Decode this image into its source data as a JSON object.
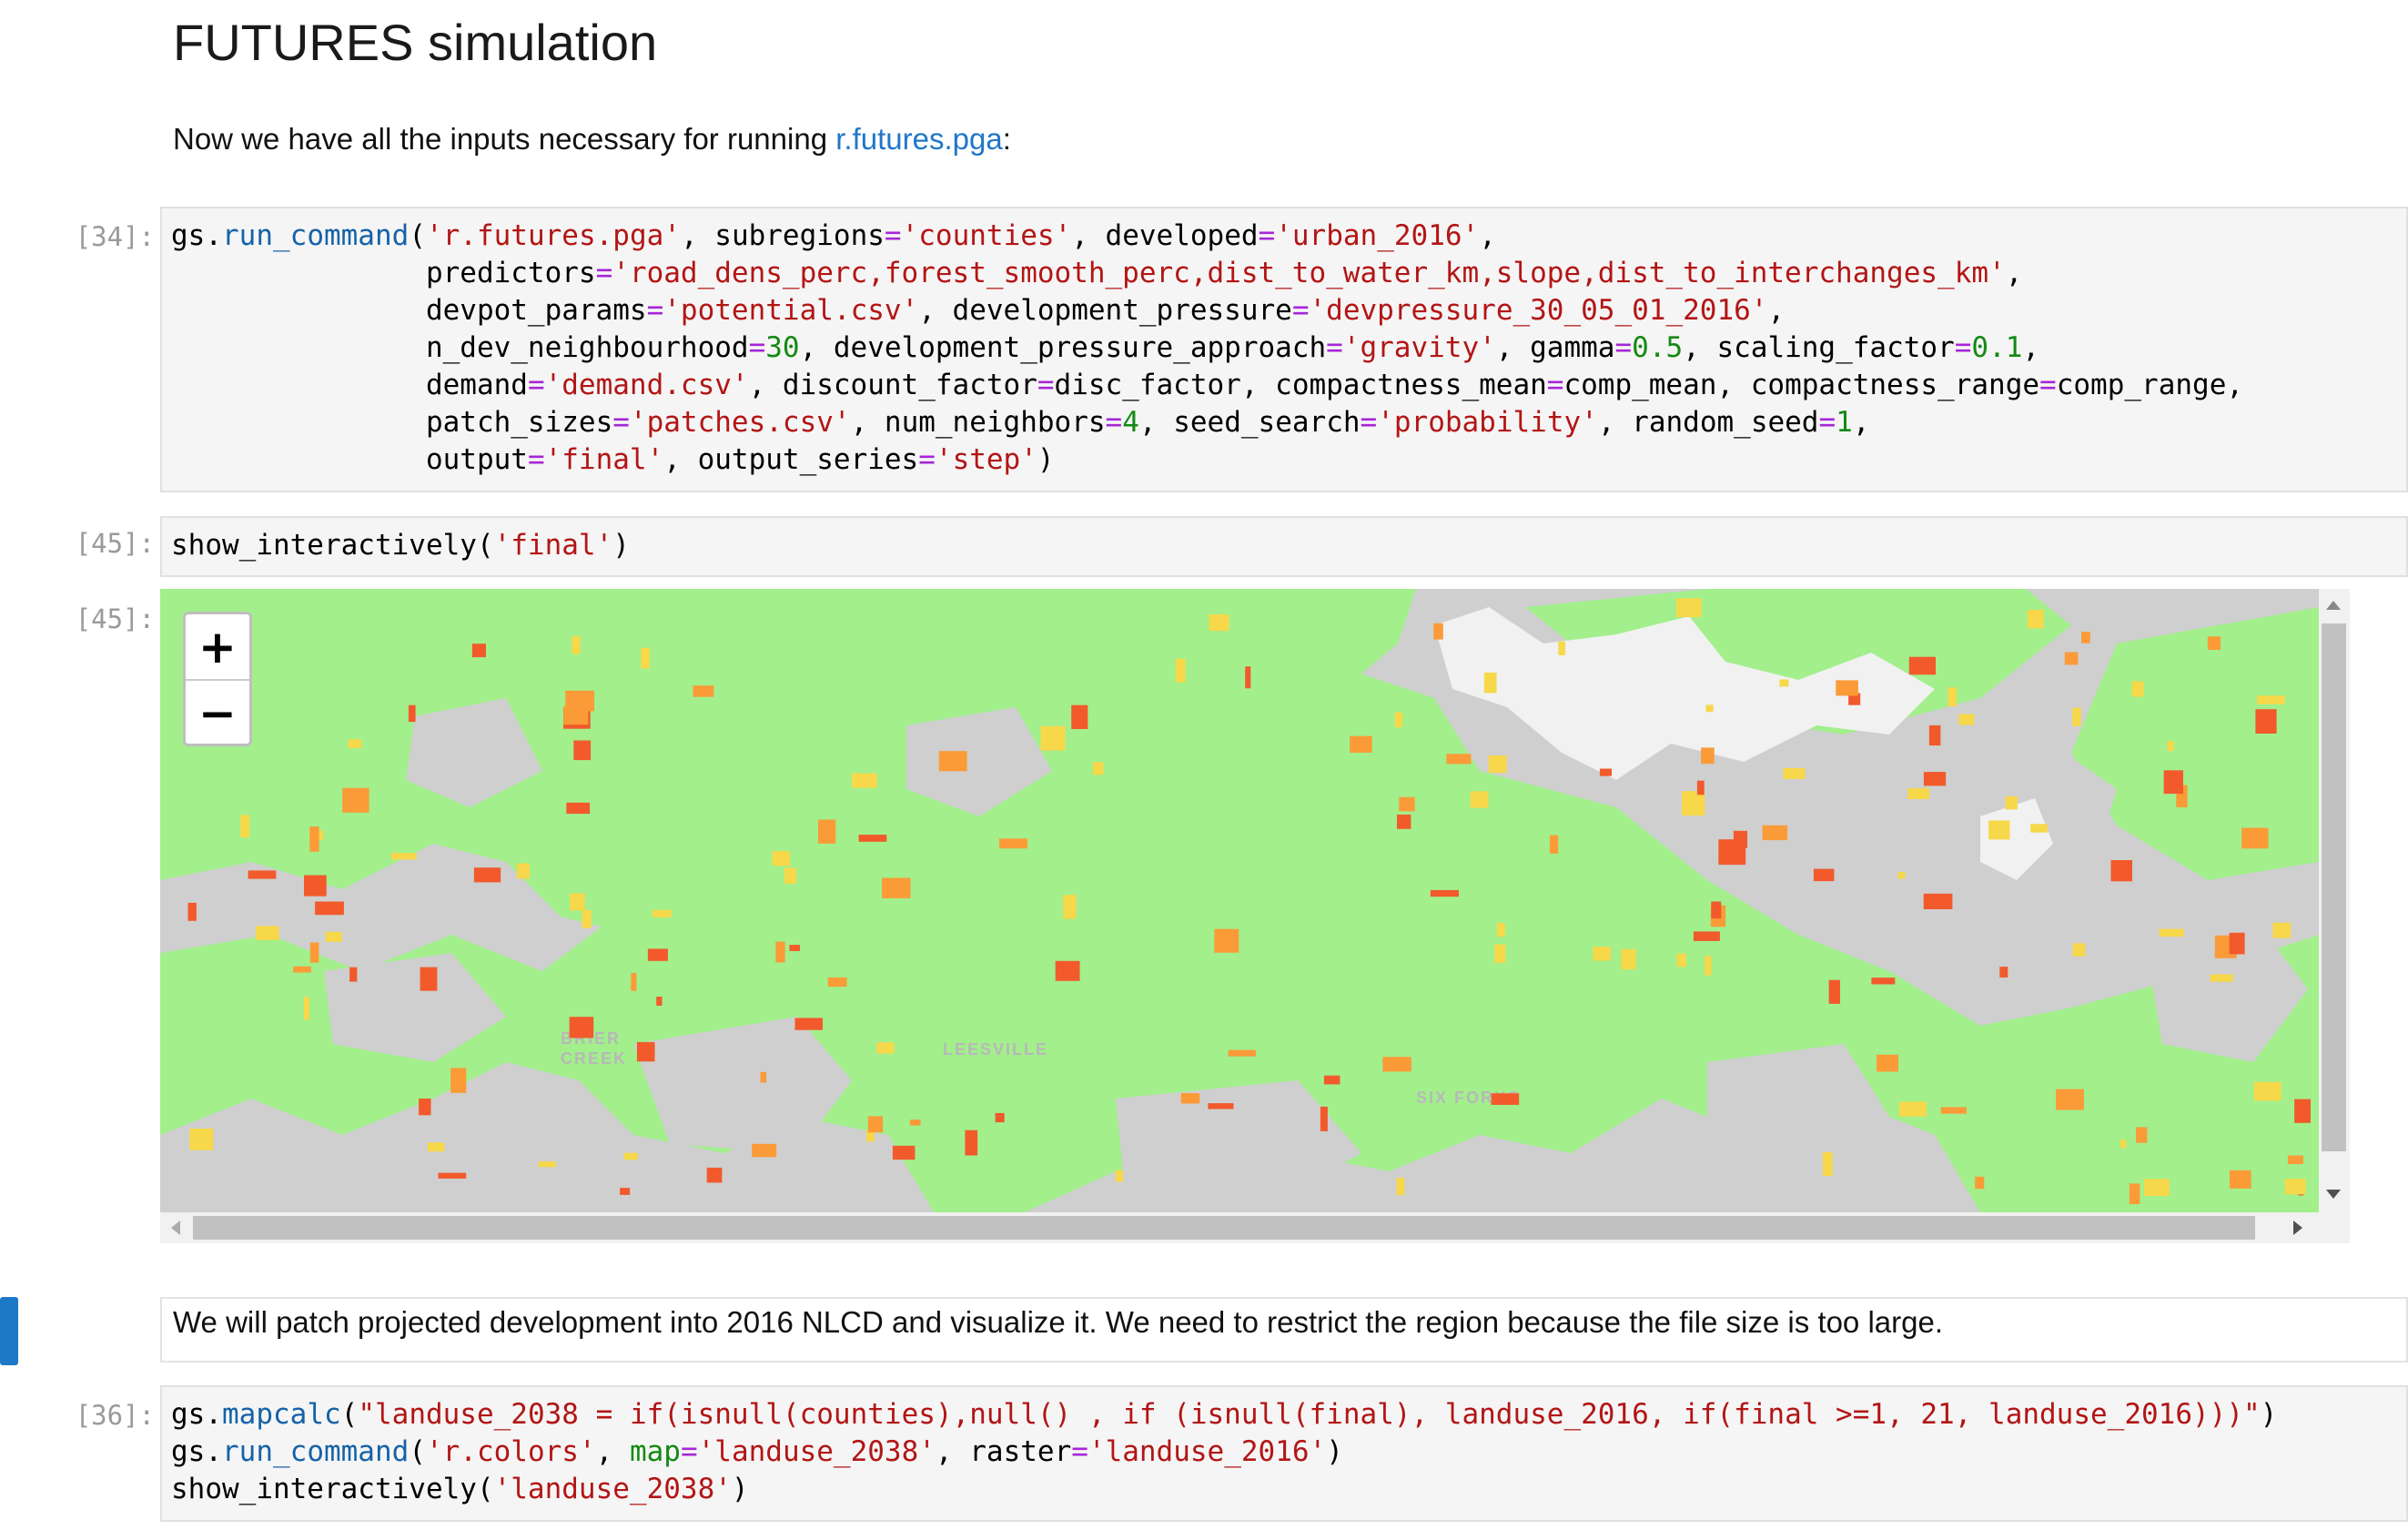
{
  "heading": "FUTURES simulation",
  "intro": {
    "text_before": "Now we have all the inputs necessary for running ",
    "link": "r.futures.pga",
    "text_after": ":"
  },
  "cells": {
    "cell34": {
      "prompt": "[34]:"
    },
    "cell45": {
      "prompt": "[45]:"
    },
    "out45": {
      "prompt": "[45]:"
    },
    "cell36": {
      "prompt": "[36]:"
    }
  },
  "map": {
    "zoom_in_label": "+",
    "zoom_out_label": "−",
    "place_labels": [
      "BRIER",
      "CREEK",
      "LEESVILLE",
      "SIX FORKS"
    ],
    "colors": {
      "background": "#cfcfcf",
      "forest": "#a2ef8c",
      "water": "#f3f3f3",
      "urban_new_high": "#f25a2c",
      "urban_new_mid": "#fa9b38",
      "urban_new_low": "#f7d84a"
    }
  },
  "markdown2": {
    "text": "We will patch projected development into 2016 NLCD and visualize it. We need to restrict the region because the file size is too large."
  },
  "colors": {
    "link": "#1f77c8",
    "active_cell_bar": "#1e78c8",
    "string": "#b31515",
    "number": "#138a13",
    "operator": "#a626d6",
    "function": "#1662a8"
  }
}
